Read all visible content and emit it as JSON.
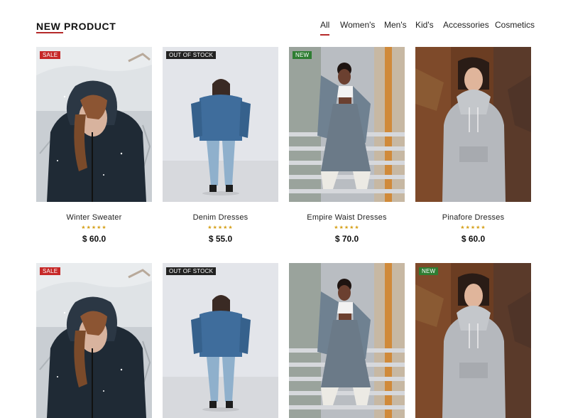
{
  "section": {
    "title": "NEW PRODUCT"
  },
  "tabs": [
    "All",
    "Women's",
    "Men's",
    "Kid's",
    "Accessories",
    "Cosmetics"
  ],
  "active_tab": "All",
  "colors": {
    "accent": "#b52a2a",
    "sale": "#c62828",
    "out_of_stock": "#222222",
    "new": "#2e7d32",
    "stars": "#d6a21e"
  },
  "products": [
    {
      "name": "Winter Sweater",
      "price": "$ 60.0",
      "badge": "SALE",
      "rating": "★★★★★"
    },
    {
      "name": "Denim Dresses",
      "price": "$ 55.0",
      "badge": "OUT OF STOCK",
      "rating": "★★★★★"
    },
    {
      "name": "Empire Waist Dresses",
      "price": "$ 70.0",
      "badge": "NEW",
      "rating": "★★★★★"
    },
    {
      "name": "Pinafore Dresses",
      "price": "$ 60.0",
      "badge": "",
      "rating": "★★★★★"
    },
    {
      "name": "",
      "price": "",
      "badge": "SALE",
      "rating": ""
    },
    {
      "name": "",
      "price": "",
      "badge": "OUT OF STOCK",
      "rating": ""
    },
    {
      "name": "",
      "price": "",
      "badge": "",
      "rating": ""
    },
    {
      "name": "",
      "price": "",
      "badge": "NEW",
      "rating": ""
    }
  ]
}
